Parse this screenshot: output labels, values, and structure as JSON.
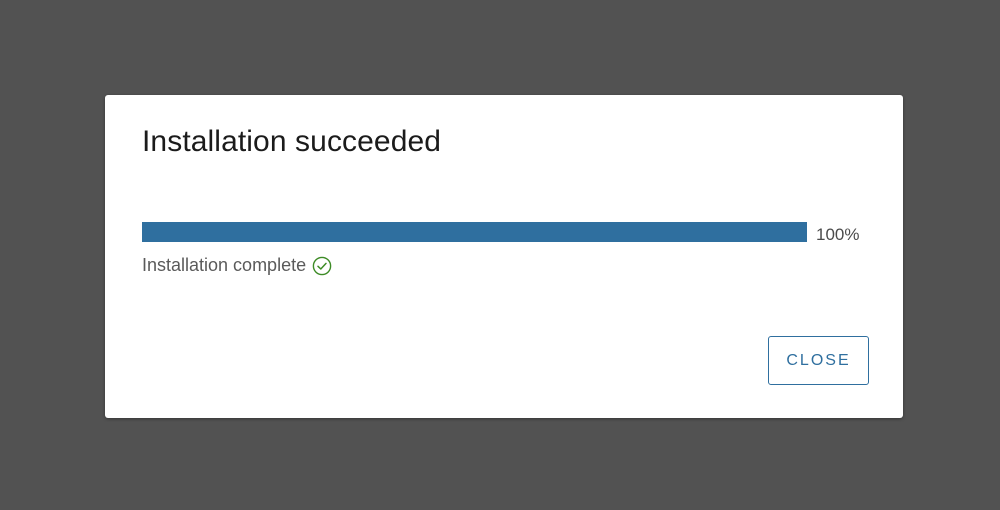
{
  "dialog": {
    "title": "Installation succeeded",
    "progress": {
      "percent_label": "100%",
      "value": 100,
      "fill_color": "#2f6f9f"
    },
    "status": {
      "text": "Installation complete",
      "icon": "check-circle-icon",
      "icon_color": "#3d8b26"
    },
    "close_label": "CLOSE"
  },
  "colors": {
    "backdrop": "#525252",
    "accent": "#2f6f9f"
  }
}
